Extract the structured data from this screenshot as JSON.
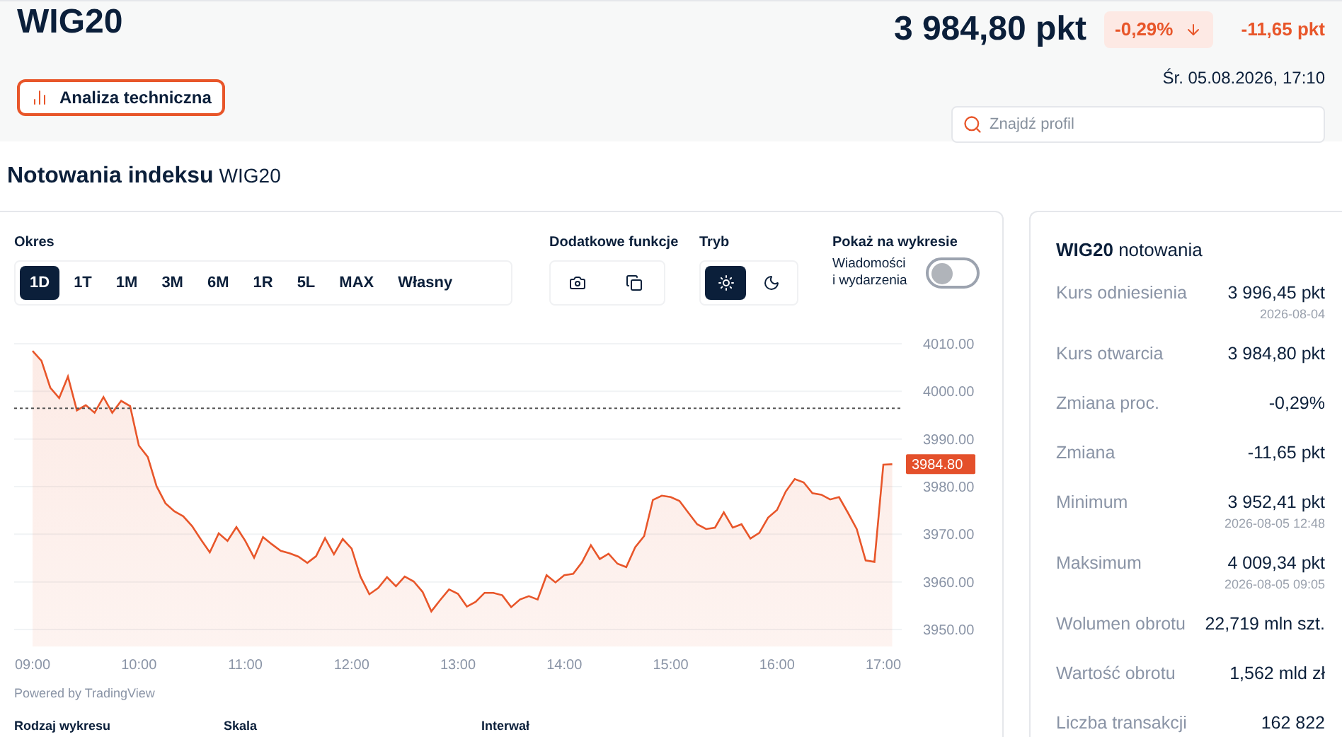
{
  "header": {
    "title": "WIG20",
    "price": "3 984,80 pkt",
    "change_pct": "-0,29%",
    "change_abs": "-11,65 pkt",
    "datetime": "Śr. 05.08.2026, 17:10",
    "analysis_button": "Analiza techniczna",
    "search": {
      "placeholder": "Znajdź profil"
    }
  },
  "section_title": {
    "text": "Notowania indeksu",
    "symbol": "WIG20"
  },
  "controls": {
    "period_label": "Okres",
    "periods": [
      {
        "label": "1D",
        "selected": true
      },
      {
        "label": "1T",
        "selected": false
      },
      {
        "label": "1M",
        "selected": false
      },
      {
        "label": "3M",
        "selected": false
      },
      {
        "label": "6M",
        "selected": false
      },
      {
        "label": "1R",
        "selected": false
      },
      {
        "label": "5L",
        "selected": false
      },
      {
        "label": "MAX",
        "selected": false
      },
      {
        "label": "Własny",
        "selected": false
      }
    ],
    "extra_label": "Dodatkowe funkcje",
    "mode_label": "Tryb",
    "modes": [
      {
        "kind": "light",
        "selected": true
      },
      {
        "kind": "dark",
        "selected": false
      }
    ],
    "show_label": "Pokaż na wykresie",
    "news_toggle": {
      "label": "Wiadomości i wydarzenia",
      "on": false
    }
  },
  "chart": {
    "chart_data": {
      "type": "area",
      "grid": true,
      "categories": [
        "09:00",
        null,
        null,
        null,
        null,
        null,
        null,
        null,
        null,
        null,
        null,
        null,
        "10:00",
        null,
        null,
        null,
        null,
        null,
        null,
        null,
        null,
        null,
        null,
        null,
        "11:00",
        null,
        null,
        null,
        null,
        null,
        null,
        null,
        null,
        null,
        null,
        null,
        "12:00",
        null,
        null,
        null,
        null,
        null,
        null,
        null,
        null,
        null,
        null,
        null,
        "13:00",
        null,
        null,
        null,
        null,
        null,
        null,
        null,
        null,
        null,
        null,
        null,
        "14:00",
        null,
        null,
        null,
        null,
        null,
        null,
        null,
        null,
        null,
        null,
        null,
        "15:00",
        null,
        null,
        null,
        null,
        null,
        null,
        null,
        null,
        null,
        null,
        null,
        "16:00",
        null,
        null,
        null,
        null,
        null,
        null,
        null,
        null,
        null,
        null,
        null,
        "17:00",
        null
      ],
      "series": [
        {
          "color": "#e8562a",
          "values": [
            4008.5,
            4006.4,
            4000.8,
            3998.6,
            4003.1,
            3996.0,
            3997.1,
            3995.5,
            3998.8,
            3995.5,
            3998.0,
            3996.9,
            3988.6,
            3986.2,
            3980.1,
            3976.5,
            3974.8,
            3973.8,
            3971.7,
            3968.9,
            3966.2,
            3970.2,
            3968.6,
            3971.5,
            3968.6,
            3965.1,
            3969.4,
            3967.9,
            3966.5,
            3966.0,
            3965.3,
            3964.0,
            3965.4,
            3969.2,
            3965.8,
            3969.0,
            3967.0,
            3961.1,
            3957.4,
            3958.7,
            3961.0,
            3959.1,
            3961.1,
            3960.1,
            3957.9,
            3953.8,
            3956.2,
            3958.4,
            3957.5,
            3954.8,
            3955.8,
            3957.7,
            3957.7,
            3957.2,
            3954.7,
            3956.3,
            3957.0,
            3956.3,
            3961.4,
            3959.9,
            3961.4,
            3961.7,
            3964.1,
            3967.7,
            3964.8,
            3965.9,
            3963.8,
            3963.1,
            3967.3,
            3969.6,
            3977.2,
            3978.1,
            3977.8,
            3977.0,
            3974.5,
            3972.1,
            3971.1,
            3971.4,
            3974.6,
            3971.4,
            3972.1,
            3969.1,
            3970.3,
            3973.5,
            3975.1,
            3979.0,
            3981.6,
            3980.9,
            3978.6,
            3978.3,
            3977.3,
            3977.8,
            3974.5,
            3971.1,
            3964.5,
            3964.2,
            3984.6,
            3984.7
          ]
        }
      ],
      "ylim": [
        3950,
        4010
      ],
      "yticks": [
        {
          "value": 3950,
          "label": "3950.00"
        },
        {
          "value": 3960,
          "label": "3960.00"
        },
        {
          "value": 3970,
          "label": "3970.00"
        },
        {
          "value": 3980,
          "label": "3980.00"
        },
        {
          "value": 3990,
          "label": "3990.00"
        },
        {
          "value": 4000,
          "label": "4000.00"
        },
        {
          "value": 4010,
          "label": "4010.00"
        }
      ],
      "ref_lines": [
        {
          "axis": "y",
          "value": 3996.45
        }
      ],
      "annotations": [
        "3984.80"
      ]
    },
    "credit": "Powered by TradingView"
  },
  "bottom_labels": [
    "Rodzaj wykresu",
    "Skala",
    "Interwał"
  ],
  "quotes": {
    "title": "**WIG20** notowania",
    "rows": [
      {
        "label": "Kurs odniesienia",
        "value": "3 996,45 pkt",
        "note": "2026-08-04"
      },
      {
        "label": "Kurs otwarcia",
        "value": "3 984,80 pkt"
      },
      {
        "label": "Zmiana proc.",
        "value": "-0,29%"
      },
      {
        "label": "Zmiana",
        "value": "-11,65 pkt"
      },
      {
        "label": "Minimum",
        "value": "3 952,41 pkt",
        "note": "2026-08-05 12:48"
      },
      {
        "label": "Maksimum",
        "value": "4 009,34 pkt",
        "note": "2026-08-05 09:05"
      },
      {
        "label": "Wolumen obrotu",
        "value": "22,719 mln szt."
      },
      {
        "label": "Wartość obrotu",
        "value": "1,562 mld zł"
      },
      {
        "label": "Liczba transakcji",
        "value": "162 822"
      }
    ]
  }
}
